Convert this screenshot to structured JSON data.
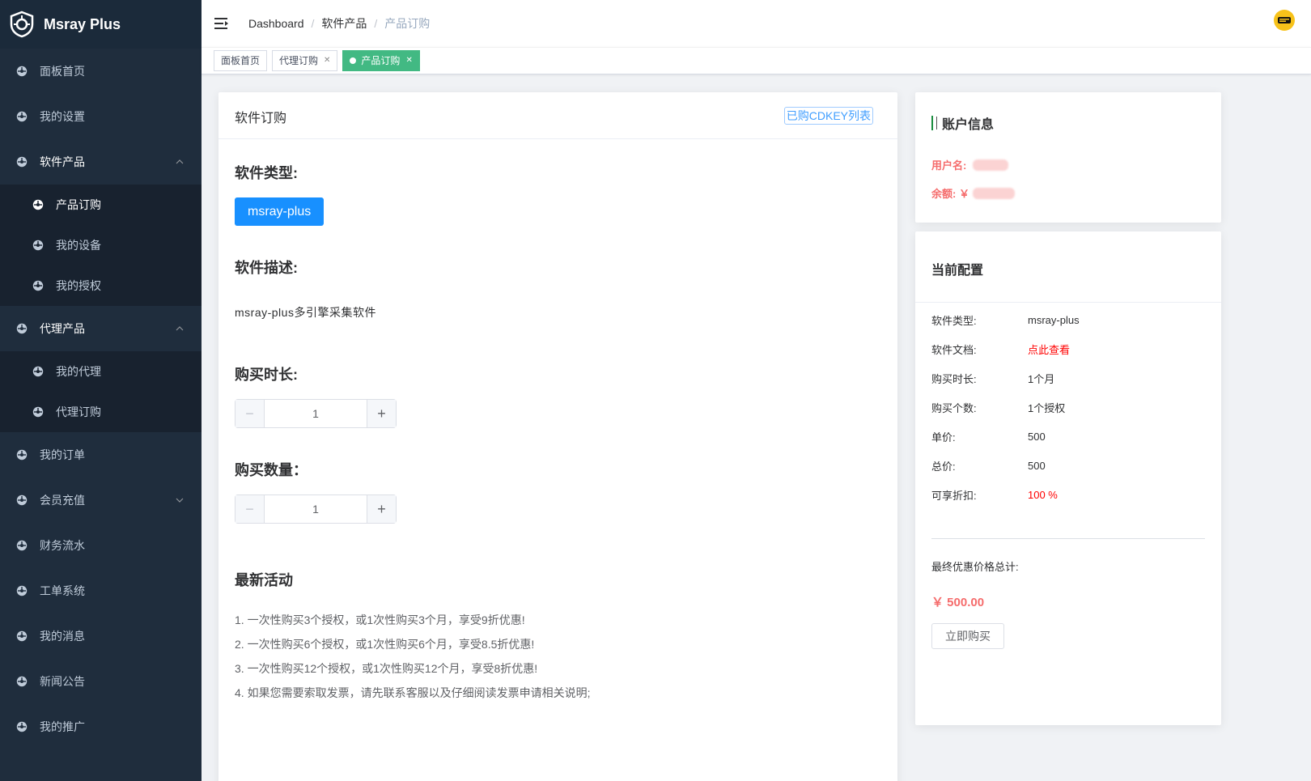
{
  "app": {
    "name": "Msray Plus"
  },
  "colors": {
    "sidebar_bg": "#1f2d3d",
    "accent": "#1890ff",
    "tag_active": "#42b983",
    "price": "#f56c6c"
  },
  "sidebar": {
    "items": [
      {
        "label": "面板首页",
        "icon": "dashboard-icon"
      },
      {
        "label": "我的设置",
        "icon": "dashboard-icon"
      },
      {
        "label": "软件产品",
        "icon": "dashboard-icon",
        "expanded": true,
        "children": [
          {
            "label": "产品订购",
            "active": true
          },
          {
            "label": "我的设备"
          },
          {
            "label": "我的授权"
          }
        ]
      },
      {
        "label": "代理产品",
        "icon": "dashboard-icon",
        "expanded": true,
        "children": [
          {
            "label": "我的代理"
          },
          {
            "label": "代理订购"
          }
        ]
      },
      {
        "label": "我的订单",
        "icon": "dashboard-icon"
      },
      {
        "label": "会员充值",
        "icon": "dashboard-icon",
        "expanded": false
      },
      {
        "label": "财务流水",
        "icon": "dashboard-icon"
      },
      {
        "label": "工单系统",
        "icon": "dashboard-icon"
      },
      {
        "label": "我的消息",
        "icon": "dashboard-icon"
      },
      {
        "label": "新闻公告",
        "icon": "dashboard-icon"
      },
      {
        "label": "我的推广",
        "icon": "dashboard-icon"
      }
    ]
  },
  "breadcrumb": [
    "Dashboard",
    "软件产品",
    "产品订购"
  ],
  "tabs": [
    {
      "label": "面板首页",
      "closable": false
    },
    {
      "label": "代理订购",
      "closable": true
    },
    {
      "label": "产品订购",
      "closable": true,
      "active": true
    }
  ],
  "order": {
    "title": "软件订购",
    "cdkey_link": "已购CDKEY列表",
    "type_title": "软件类型:",
    "type_value": "msray-plus",
    "desc_title": "软件描述:",
    "desc_text": "msray-plus多引擎采集软件",
    "duration_title": "购买时长:",
    "duration_value": "1",
    "qty_title": "购买数量：",
    "qty_value": "1",
    "promo_title": "最新活动",
    "promos": [
      "1. 一次性购买3个授权，或1次性购买3个月，享受9折优惠!",
      "2. 一次性购买6个授权，或1次性购买6个月，享受8.5折优惠!",
      "3. 一次性购买12个授权，或1次性购买12个月，享受8折优惠!",
      "4. 如果您需要索取发票，请先联系客服以及仔细阅读发票申请相关说明;"
    ]
  },
  "account": {
    "title": "账户信息",
    "username_label": "用户名:",
    "balance_label": "余额: ￥"
  },
  "config": {
    "title": "当前配置",
    "rows": [
      {
        "k": "软件类型:",
        "v": "msray-plus",
        "red": false
      },
      {
        "k": "软件文档:",
        "v": "点此查看",
        "red": true
      },
      {
        "k": "购买时长:",
        "v": "1个月",
        "red": false
      },
      {
        "k": "购买个数:",
        "v": "1个授权",
        "red": false
      },
      {
        "k": "单价:",
        "v": "500",
        "red": false
      },
      {
        "k": "总价:",
        "v": "500",
        "red": false
      },
      {
        "k": "可享折扣:",
        "v": "100 %",
        "red": true
      }
    ],
    "total_label": "最终优惠价格总计:",
    "total_value": "￥ 500.00",
    "buy_label": "立即购买"
  }
}
